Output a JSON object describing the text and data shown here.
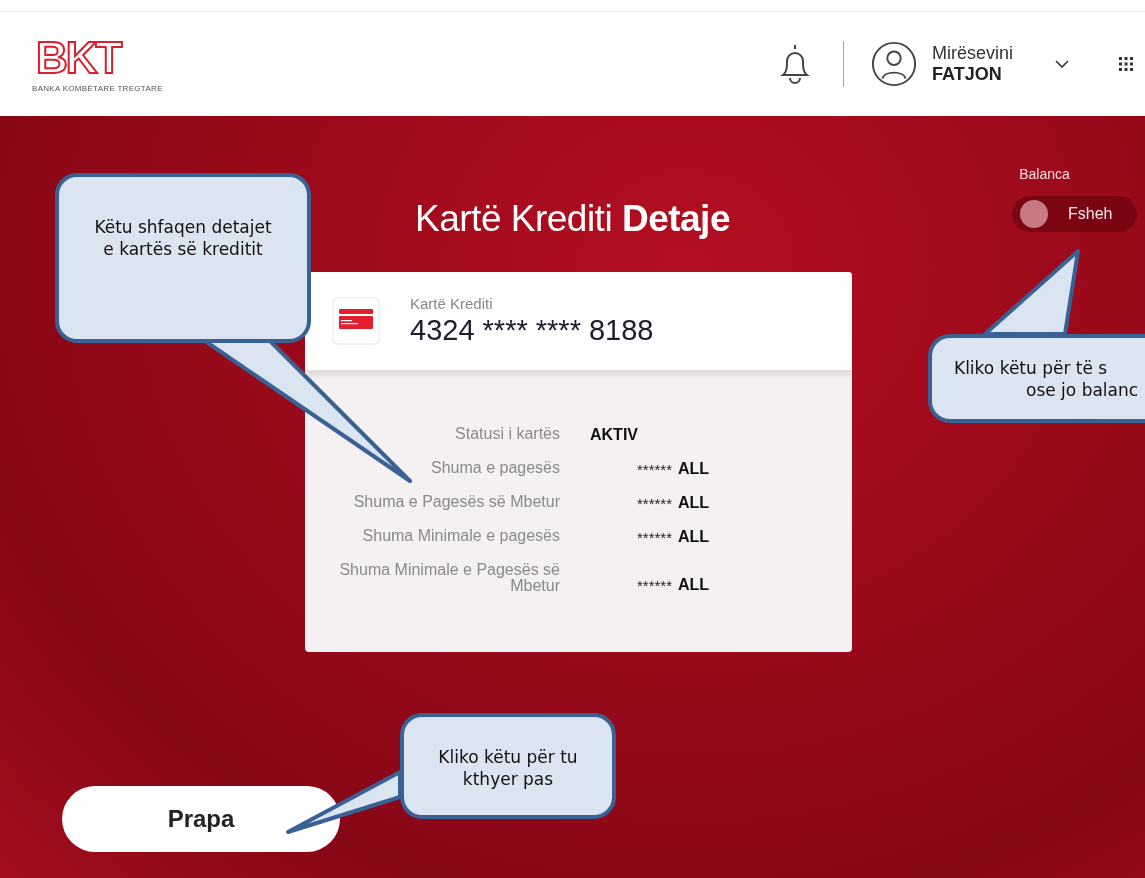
{
  "header": {
    "logo_text": "BKT",
    "logo_tagline": "BANKA KOMBËTARE TREGTARE",
    "greeting": "Mirësevini",
    "user_name": "FATJON"
  },
  "balance_toggle": {
    "label": "Balanca",
    "state_text": "Fsheh",
    "on": false
  },
  "page_title": {
    "regular": "Kartë Krediti",
    "bold": "Detaje"
  },
  "card": {
    "type_label": "Kartë Krediti",
    "number": "4324 **** **** 8188",
    "details": [
      {
        "label": "Statusi i kartës",
        "value": "AKTIV"
      },
      {
        "label": "Shuma e pagesës",
        "value": "******",
        "currency": "ALL"
      },
      {
        "label": "Shuma e Pagesës së Mbetur",
        "value": "******",
        "currency": "ALL"
      },
      {
        "label": "Shuma Minimale e pagesës",
        "value": "******",
        "currency": "ALL"
      },
      {
        "label": "Shuma Minimale e Pagesës së Mbetur",
        "value": "******",
        "currency": "ALL"
      }
    ]
  },
  "back_button": "Prapa",
  "callouts": [
    {
      "kind": "details",
      "lines": [
        "Këtu shfaqen detajet",
        "e kartës së kreditit"
      ]
    },
    {
      "kind": "toggle",
      "lines": [
        "Kliko këtu për të s",
        "ose jo balanc"
      ]
    },
    {
      "kind": "back",
      "lines": [
        "Kliko këtu për tu",
        "kthyer pas"
      ]
    }
  ]
}
